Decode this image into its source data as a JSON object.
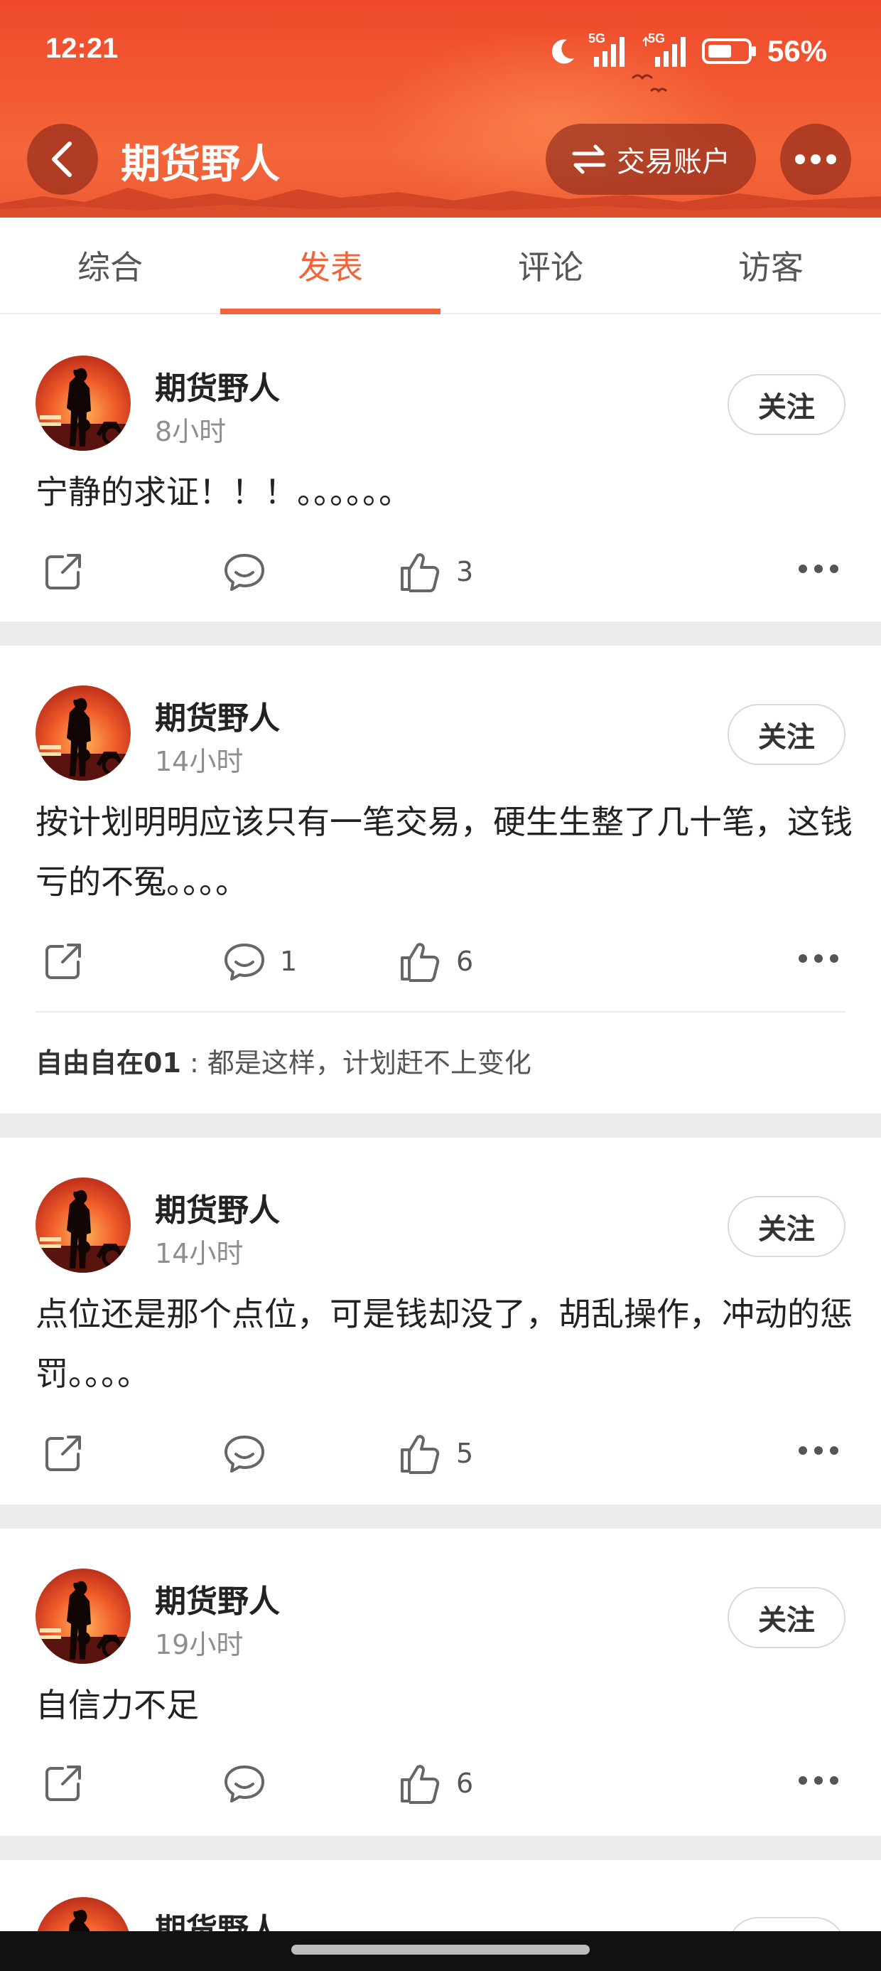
{
  "status_bar": {
    "time": "12:21",
    "signal_1_label": "5G",
    "signal_2_label": "5G",
    "battery": "56%"
  },
  "header": {
    "title": "期货野人",
    "trade_button_label": "交易账户",
    "accent_color": "#f0653b"
  },
  "tabs": [
    {
      "label": "综合",
      "active": false
    },
    {
      "label": "发表",
      "active": true
    },
    {
      "label": "评论",
      "active": false
    },
    {
      "label": "访客",
      "active": false
    }
  ],
  "posts": [
    {
      "author": "期货野人",
      "time": "8小时",
      "follow_label": "关注",
      "content": "宁静的求证！！！。。。。。。",
      "comments_count": "",
      "likes_count": "3"
    },
    {
      "author": "期货野人",
      "time": "14小时",
      "follow_label": "关注",
      "content": "按计划明明应该只有一笔交易，硬生生整了几十笔，这钱亏的不冤。。。。",
      "comments_count": "1",
      "likes_count": "6",
      "comment_preview": {
        "user": "自由自在01",
        "separator": ":",
        "text": "都是这样，计划赶不上变化"
      }
    },
    {
      "author": "期货野人",
      "time": "14小时",
      "follow_label": "关注",
      "content": "点位还是那个点位，可是钱却没了，胡乱操作，冲动的惩罚。。。。",
      "comments_count": "",
      "likes_count": "5"
    },
    {
      "author": "期货野人",
      "time": "19小时",
      "follow_label": "关注",
      "content": "自信力不足",
      "comments_count": "",
      "likes_count": "6"
    },
    {
      "author": "期货野人",
      "time": "",
      "follow_label": "",
      "content": "",
      "comments_count": "",
      "likes_count": ""
    }
  ]
}
